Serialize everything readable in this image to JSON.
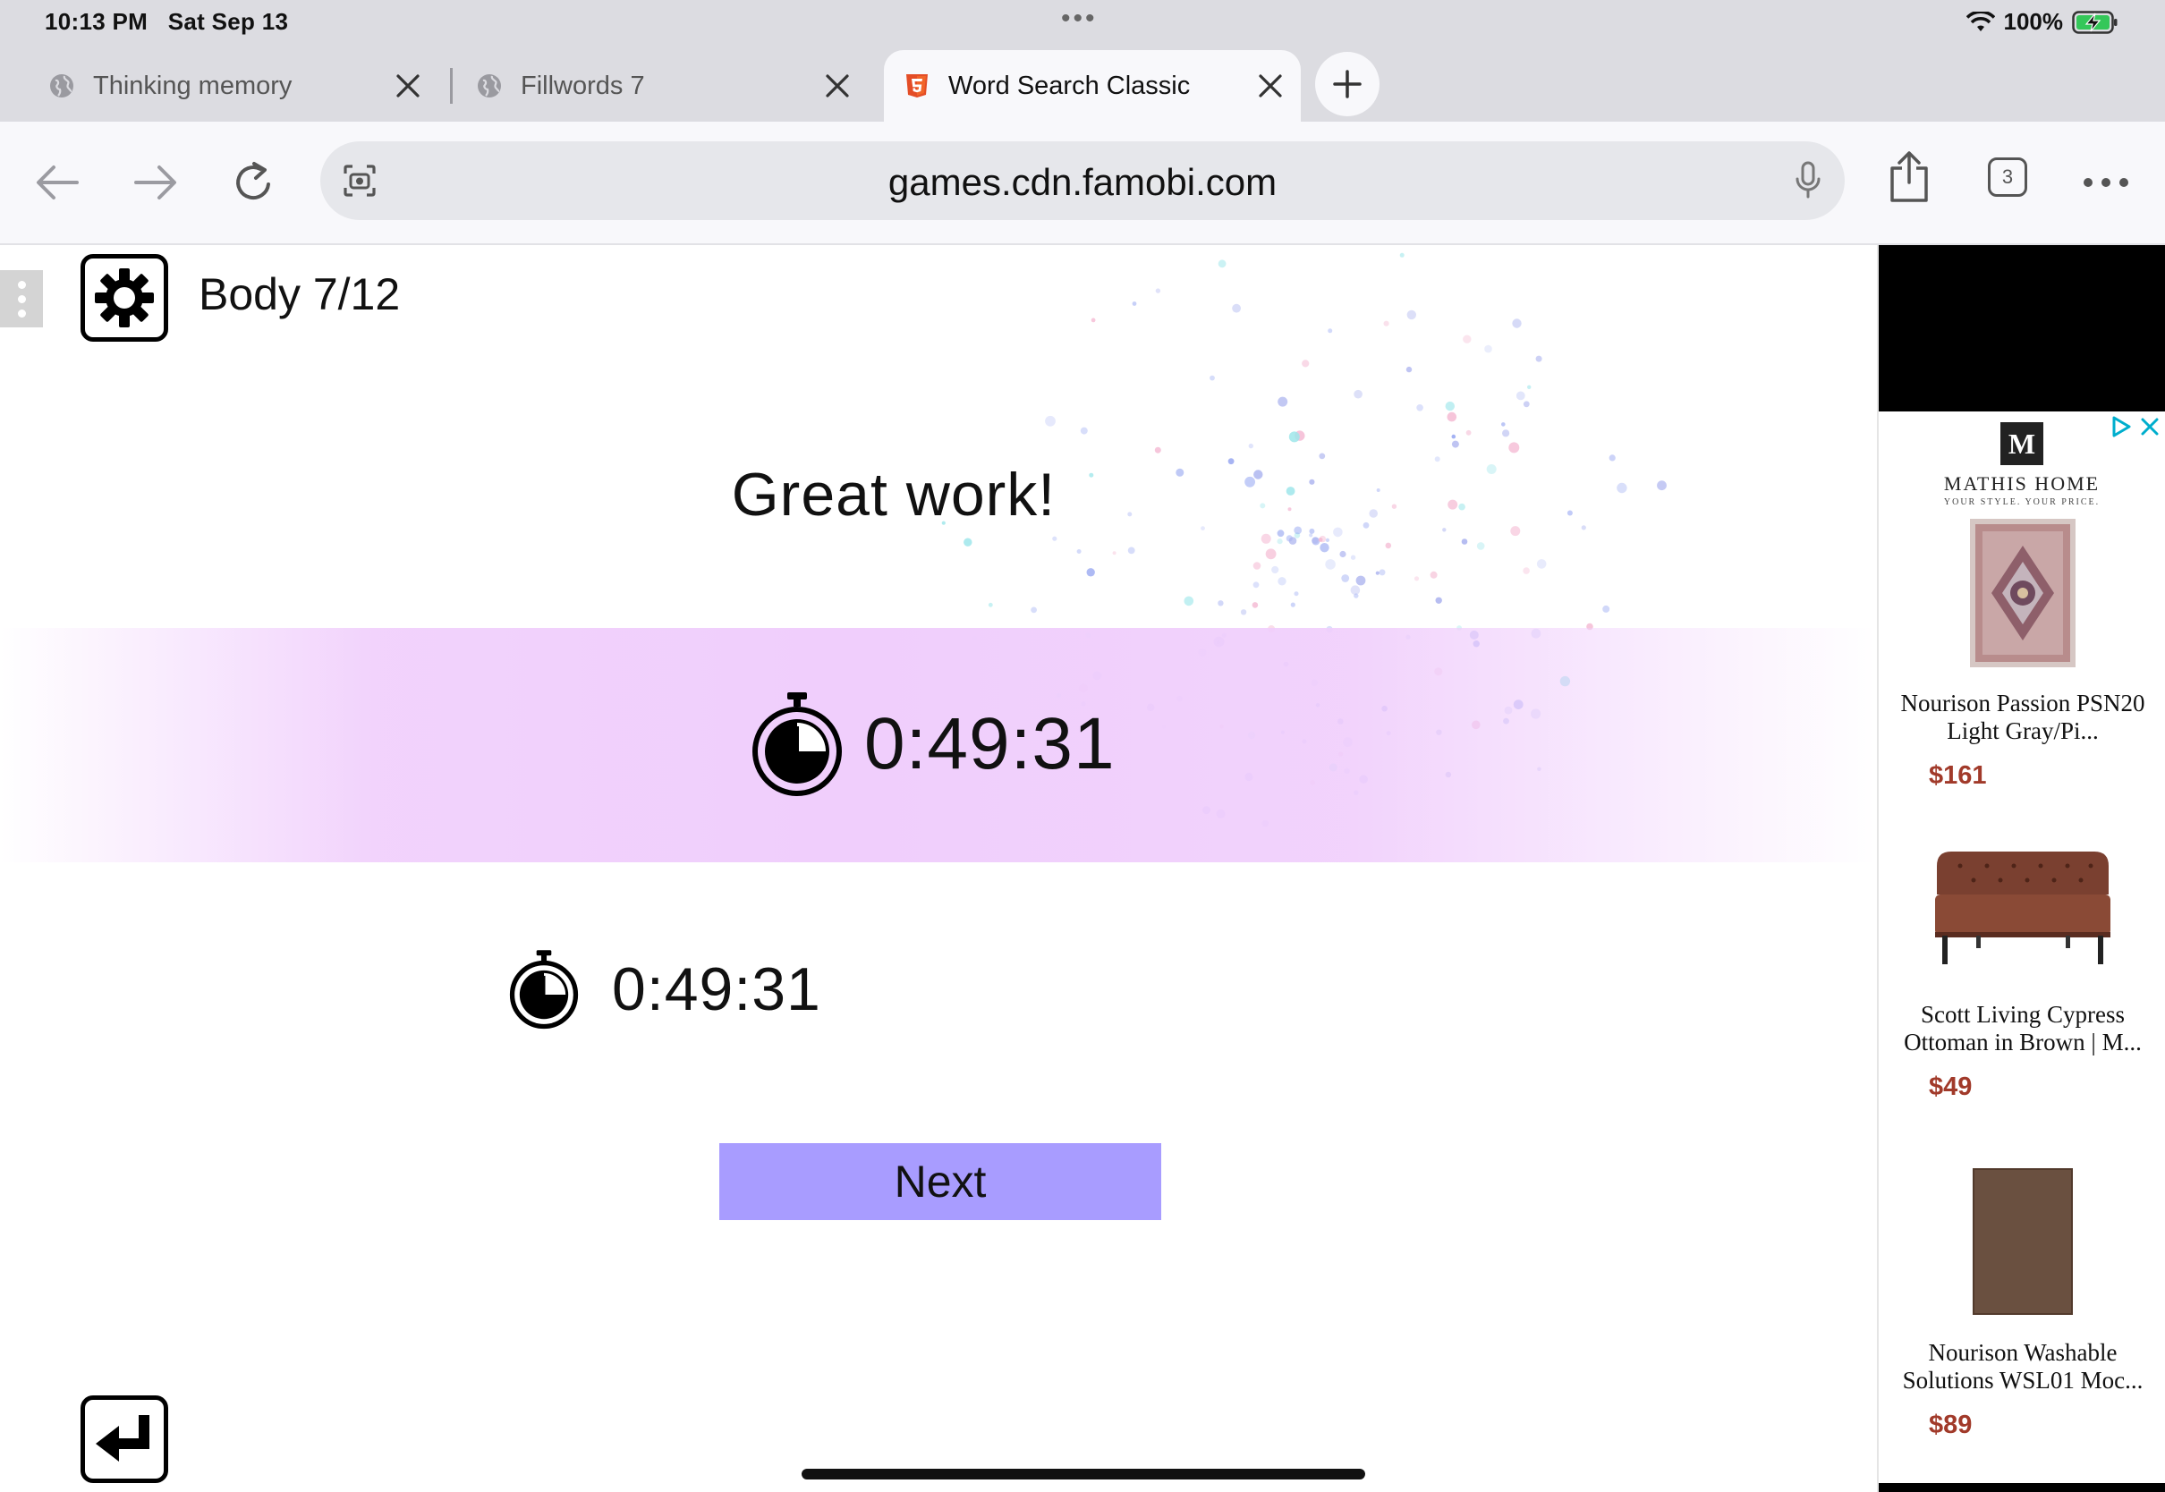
{
  "status_bar": {
    "time": "10:13 PM",
    "date": "Sat Sep 13",
    "battery": "100%"
  },
  "tabs": [
    {
      "title": "Thinking memory",
      "active": false
    },
    {
      "title": "Fillwords 7",
      "active": false
    },
    {
      "title": "Word Search Classic",
      "active": true
    }
  ],
  "toolbar": {
    "url": "games.cdn.famobi.com",
    "tab_count": "3"
  },
  "game": {
    "level_label": "Body 7/12",
    "headline": "Great work!",
    "current_time": "0:49:31",
    "best_time": "0:49:31",
    "next_label": "Next"
  },
  "ad": {
    "logo_letter": "M",
    "brand": "MATHIS HOME",
    "tagline": "YOUR STYLE. YOUR PRICE.",
    "items": [
      {
        "name": "Nourison Passion PSN20 Light Gray/Pi...",
        "price": "$161"
      },
      {
        "name": "Scott Living Cypress Ottoman in Brown | M...",
        "price": "$49"
      },
      {
        "name": "Nourison Washable Solutions WSL01 Moc...",
        "price": "$89"
      }
    ]
  },
  "colors": {
    "accent_tab_icon": "#e44d26",
    "next_button": "#a89cff",
    "time_band": "#f0cefc",
    "price": "#a13a2a",
    "ad_choices": "#00aecd"
  }
}
